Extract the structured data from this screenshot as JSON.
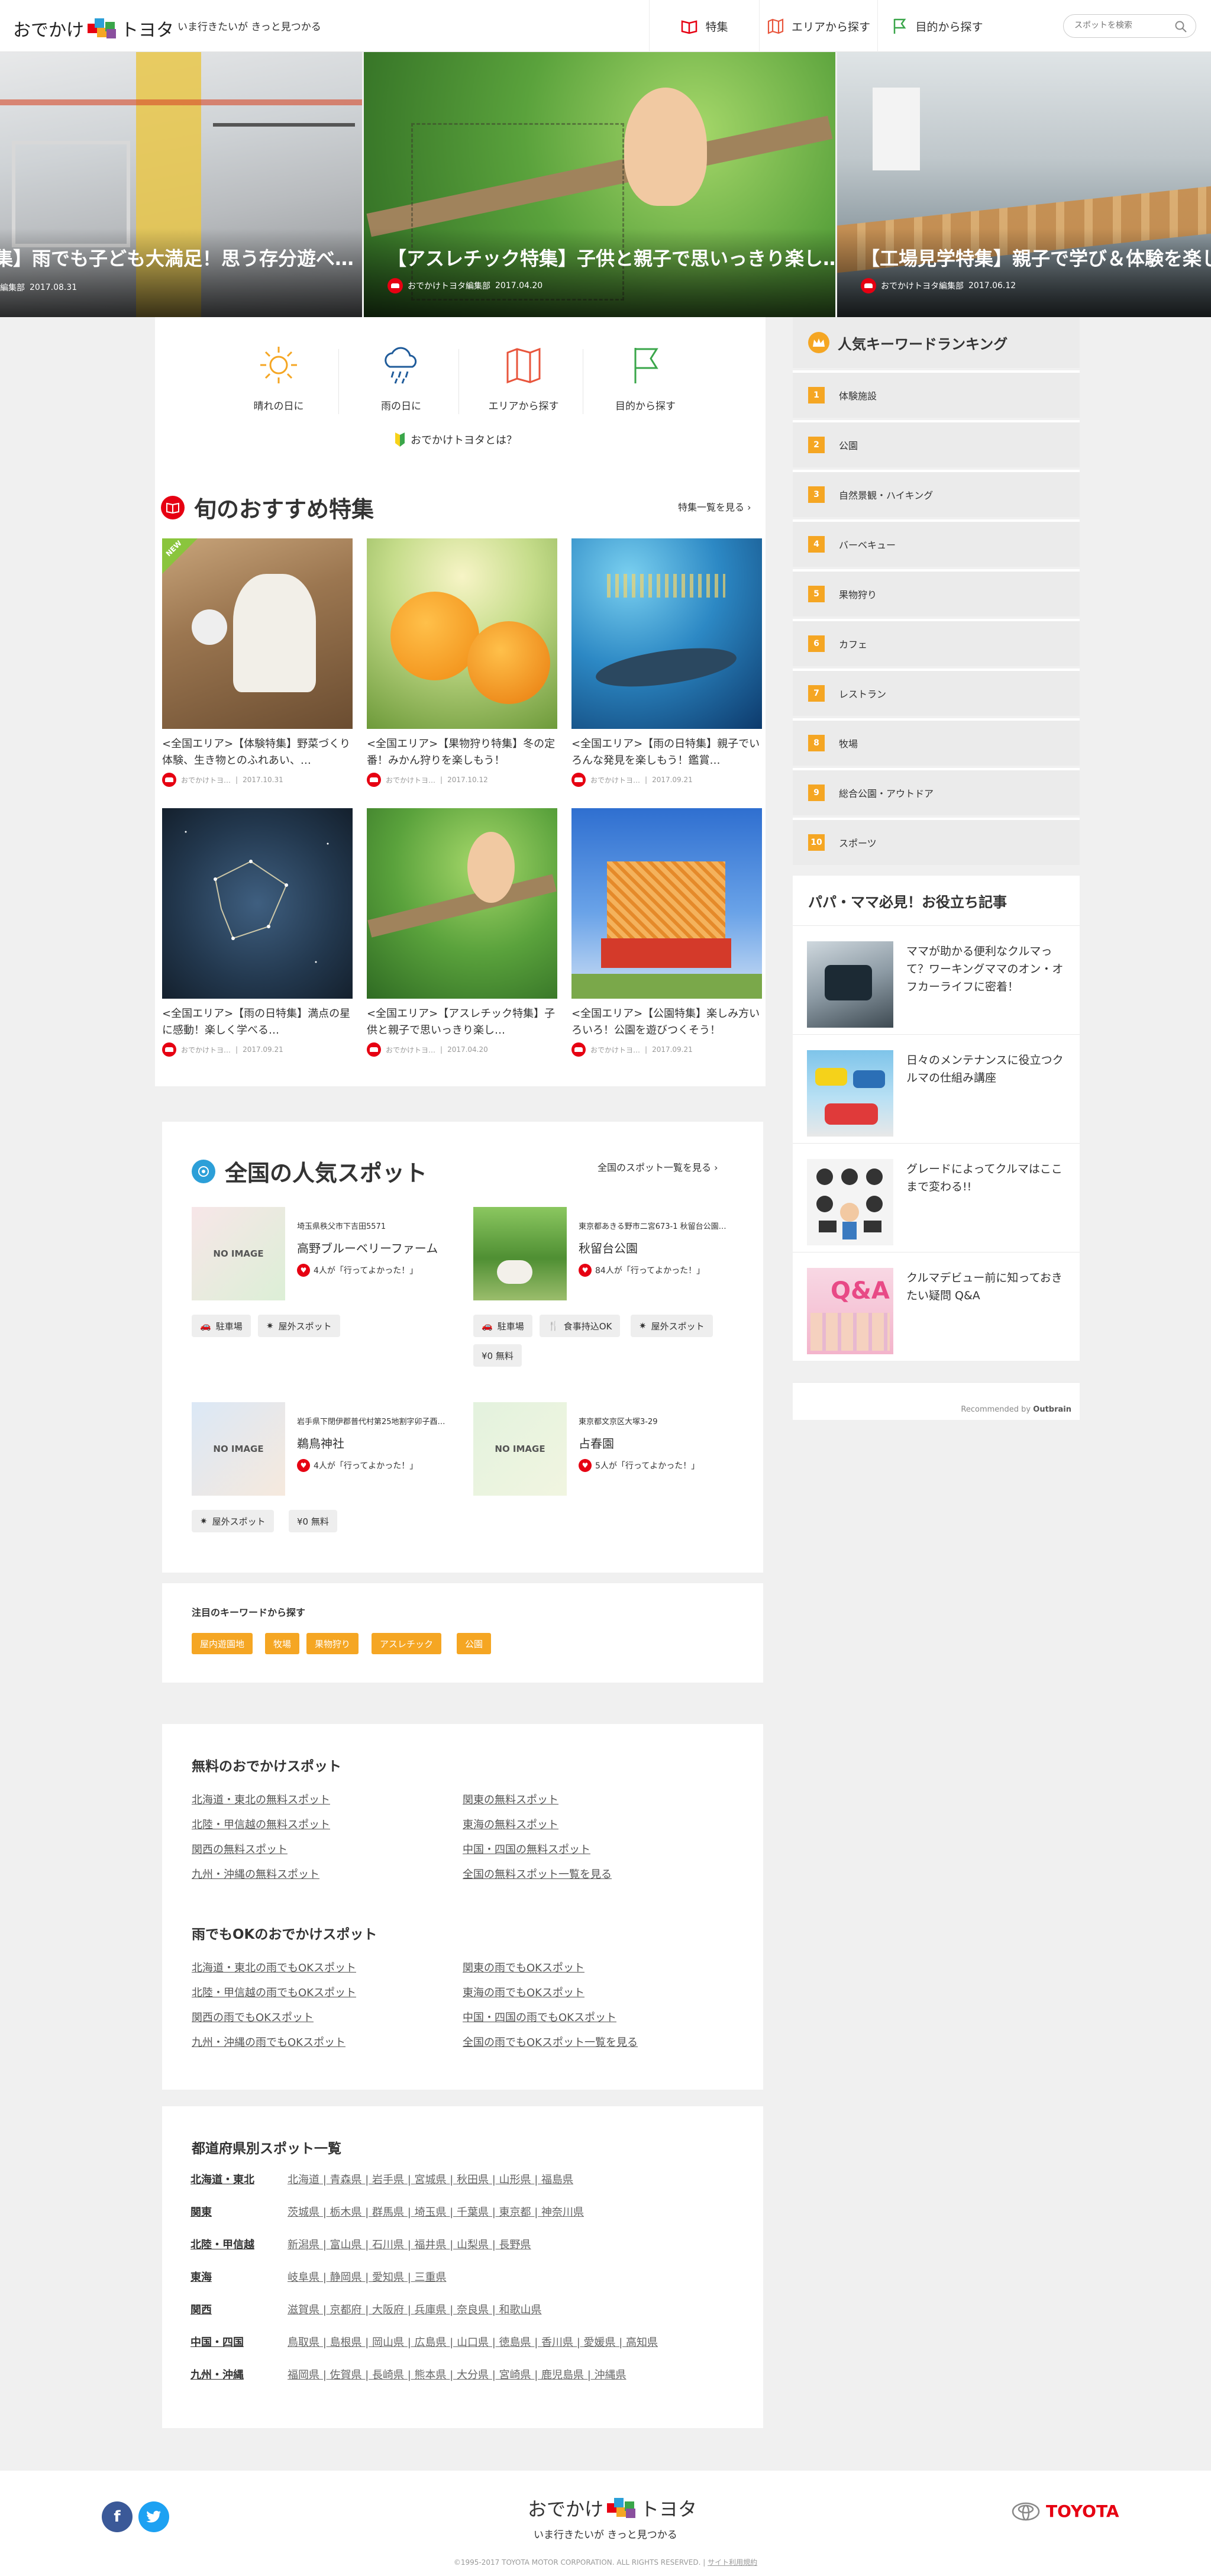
{
  "header": {
    "logo_left": "おでかけ",
    "logo_right": "トヨタ",
    "tagline": "いま行きたいが きっと見つかる",
    "nav": [
      "特集",
      "エリアから探す",
      "目的から探す"
    ],
    "search_placeholder": "スポットを検索"
  },
  "hero": [
    {
      "title": "集】雨でも子ども大満足！思う存分遊べ…",
      "author": "編集部",
      "date": "2017.08.31"
    },
    {
      "title": "【アスレチック特集】子供と親子で思いっきり楽し…",
      "author": "おでかけトヨタ編集部",
      "date": "2017.04.20"
    },
    {
      "title": "【工場見学特集】親子で学び＆体験を楽しめ",
      "author": "おでかけトヨタ編集部",
      "date": "2017.06.12"
    }
  ],
  "categories": [
    "晴れの日に",
    "雨の日に",
    "エリアから探す",
    "目的から探す"
  ],
  "about_link": "おでかけトヨタとは？",
  "features": {
    "title": "旬のおすすめ特集",
    "more": "特集一覧を見る",
    "new_label": "NEW",
    "cards": [
      {
        "title": "<全国エリア>【体験特集】野菜づくり体験、生き物とのふれあい、…",
        "author": "おでかけトヨ…",
        "date": "2017.10.31"
      },
      {
        "title": "<全国エリア>【果物狩り特集】冬の定番！みかん狩りを楽しもう！",
        "author": "おでかけトヨ…",
        "date": "2017.10.12"
      },
      {
        "title": "<全国エリア>【雨の日特集】親子でいろんな発見を楽しもう！鑑賞…",
        "author": "おでかけトヨ…",
        "date": "2017.09.21"
      },
      {
        "title": "<全国エリア>【雨の日特集】満点の星に感動！楽しく学べる…",
        "author": "おでかけトヨ…",
        "date": "2017.09.21"
      },
      {
        "title": "<全国エリア>【アスレチック特集】子供と親子で思いっきり楽し…",
        "author": "おでかけトヨ…",
        "date": "2017.04.20"
      },
      {
        "title": "<全国エリア>【公園特集】楽しみ方いろいろ！公園を遊びつくそう！",
        "author": "おでかけトヨ…",
        "date": "2017.09.21"
      }
    ]
  },
  "spots": {
    "title": "全国の人気スポット",
    "more": "全国のスポット一覧を見る",
    "no_image": "NO IMAGE",
    "items": [
      {
        "addr": "埼玉県秩父市下吉田5571",
        "name": "高野ブルーベリーファーム",
        "likes": "4人が「行ってよかった！」",
        "tags": [
          "駐車場",
          "屋外スポット"
        ]
      },
      {
        "addr": "東京都あきる野市二宮673-1 秋留台公園…",
        "name": "秋留台公園",
        "likes": "84人が「行ってよかった！」",
        "tags": [
          "駐車場",
          "食事持込OK",
          "屋外スポット",
          "¥0 無料"
        ]
      },
      {
        "addr": "岩手県下閉伊郡普代村第25地割字卯子酉…",
        "name": "鵜鳥神社",
        "likes": "4人が「行ってよかった！」",
        "tags": [
          "屋外スポット",
          "¥0 無料"
        ]
      },
      {
        "addr": "東京都文京区大塚3-29",
        "name": "占春園",
        "likes": "5人が「行ってよかった！」",
        "tags": []
      }
    ]
  },
  "keywords": {
    "title": "注目のキーワードから探す",
    "items": [
      "屋内遊園地",
      "牧場",
      "果物狩り",
      "アスレチック",
      "公園"
    ]
  },
  "free_spots": {
    "title": "無料のおでかけスポット",
    "links": [
      "北海道・東北の無料スポット",
      "関東の無料スポット",
      "北陸・甲信越の無料スポット",
      "東海の無料スポット",
      "関西の無料スポット",
      "中国・四国の無料スポット",
      "九州・沖縄の無料スポット",
      "全国の無料スポット一覧を見る"
    ]
  },
  "rain_spots": {
    "title": "雨でもOKのおでかけスポット",
    "links": [
      "北海道・東北の雨でもOKスポット",
      "関東の雨でもOKスポット",
      "北陸・甲信越の雨でもOKスポット",
      "東海の雨でもOKスポット",
      "関西の雨でもOKスポット",
      "中国・四国の雨でもOKスポット",
      "九州・沖縄の雨でもOKスポット",
      "全国の雨でもOKスポット一覧を見る"
    ]
  },
  "prefectures": {
    "title": "都道府県別スポット一覧",
    "regions": [
      {
        "name": "北海道・東北",
        "prefs": "北海道 | 青森県 | 岩手県 | 宮城県 | 秋田県 | 山形県 | 福島県"
      },
      {
        "name": "関東",
        "prefs": "茨城県 | 栃木県 | 群馬県 | 埼玉県 | 千葉県 | 東京都 | 神奈川県"
      },
      {
        "name": "北陸・甲信越",
        "prefs": "新潟県 | 富山県 | 石川県 | 福井県 | 山梨県 | 長野県"
      },
      {
        "name": "東海",
        "prefs": "岐阜県 | 静岡県 | 愛知県 | 三重県"
      },
      {
        "name": "関西",
        "prefs": "滋賀県 | 京都府 | 大阪府 | 兵庫県 | 奈良県 | 和歌山県"
      },
      {
        "name": "中国・四国",
        "prefs": "鳥取県 | 島根県 | 岡山県 | 広島県 | 山口県 | 徳島県 | 香川県 | 愛媛県 | 高知県"
      },
      {
        "name": "九州・沖縄",
        "prefs": "福岡県 | 佐賀県 | 長崎県 | 熊本県 | 大分県 | 宮崎県 | 鹿児島県 | 沖縄県"
      }
    ]
  },
  "ranking": {
    "title": "人気キーワードランキング",
    "items": [
      "体験施設",
      "公園",
      "自然景観・ハイキング",
      "バーベキュー",
      "果物狩り",
      "カフェ",
      "レストラン",
      "牧場",
      "総合公園・アウトドア",
      "スポーツ"
    ]
  },
  "articles": {
    "title": "パパ・ママ必見！お役立ち記事",
    "items": [
      "ママが助かる便利なクルマって？ワーキングママのオン・オフカーライフに密着！",
      "日々のメンテナンスに役立つクルマの仕組み講座",
      "グレードによってクルマはここまで変わる!!",
      "クルマデビュー前に知っておきたい疑問 Q&A"
    ],
    "qa_badge": "Q&A",
    "recommended": "Recommended by",
    "recommended_brand": "Outbrain"
  },
  "footer": {
    "logo_left": "おでかけ",
    "logo_right": "トヨタ",
    "tagline": "いま行きたいが きっと見つかる",
    "brand": "TOYOTA",
    "copyright": "©1995-2017 TOYOTA MOTOR CORPORATION. ALL RIGHTS RESERVED.",
    "terms": "サイト利用規約"
  }
}
